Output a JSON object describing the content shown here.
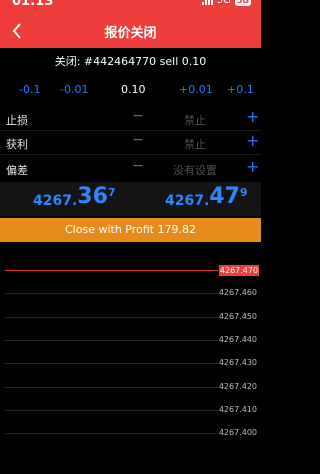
{
  "status_bar": {
    "time": "01:13",
    "network": "5G",
    "badge": "5G"
  },
  "header": {
    "title": "报价关闭"
  },
  "order": {
    "text": "关闭: #442464770 sell 0.10"
  },
  "volume": {
    "minus_1": "-0.1",
    "minus_01": "-0.01",
    "value": "0.10",
    "plus_01": "+0.01",
    "plus_1": "+0.1"
  },
  "params": [
    {
      "label": "止损",
      "minus": "−",
      "value": "禁止",
      "plus": "+"
    },
    {
      "label": "获利",
      "minus": "−",
      "value": "禁止",
      "plus": "+"
    },
    {
      "label": "偏差",
      "minus": "−",
      "value": "没有设置",
      "plus": "+"
    }
  ],
  "prices": {
    "bid": {
      "base": "4267.",
      "big": "36",
      "sup": "7"
    },
    "ask": {
      "base": "4267.",
      "big": "47",
      "sup": "9"
    }
  },
  "close_button": {
    "label": "Close with Profit 179.82"
  },
  "tick_chart": {
    "current": "4267.470",
    "levels": [
      "4267.470",
      "4267.460",
      "4267.450",
      "4267.440",
      "4267.430",
      "4267.420",
      "4267.410",
      "4267.400"
    ]
  },
  "colors": {
    "header": "#ee3e3b",
    "accent_blue": "#1a7bff",
    "close_button": "#e88b1a"
  }
}
